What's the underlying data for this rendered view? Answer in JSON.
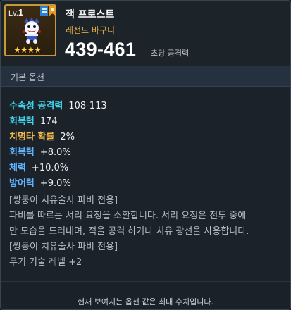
{
  "item": {
    "level_prefix": "Lv.",
    "level": "1",
    "name": "잭 프로스트",
    "grade": "레전드 바구니",
    "stars": "★★★★",
    "attack_range": "439-461",
    "attack_label": "초당 공격력"
  },
  "section": {
    "title": "기본 옵션"
  },
  "options": [
    {
      "label": "수속성 공격력",
      "value": "108-113",
      "color": "#40d2e8"
    },
    {
      "label": "회복력",
      "value": "174",
      "color": "#40d2e8"
    },
    {
      "label": "치명타 확률",
      "value": "2%",
      "color": "#f0b84a"
    },
    {
      "label": "회복력",
      "value": "+8.0%",
      "color": "#62b4ff"
    },
    {
      "label": "체력",
      "value": "+10.0%",
      "color": "#62b4ff"
    },
    {
      "label": "방어력",
      "value": "+9.0%",
      "color": "#62b4ff"
    }
  ],
  "description": [
    "[쌍둥이 치유술사 파비 전용]",
    "파비를 따르는 서리 요정을 소환합니다. 서리 요정은 전투 중에",
    "만 모습을 드러내며, 적을 공격 하거나 치유 광선을 사용합니다.",
    "[쌍둥이 치유술사 파비 전용]",
    "무기 기술 레벨 +2"
  ],
  "footer": {
    "note": "현재 보여지는 옵션 값은 최대 수치입니다."
  },
  "icons": [
    "book-badge-icon",
    "ribbon-badge-icon",
    "jack-frost-character-icon",
    "star-icon"
  ]
}
